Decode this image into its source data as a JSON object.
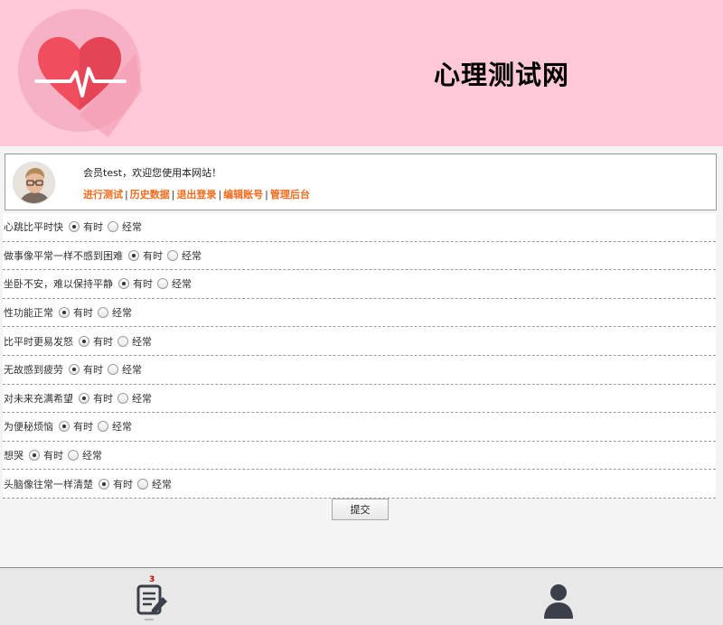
{
  "header": {
    "site_title": "心理测试网",
    "logo_icon": "heartbeat-logo-icon"
  },
  "user": {
    "welcome": "会员test，欢迎您使用本网站！",
    "links": [
      "进行测试",
      "历史数据",
      "退出登录",
      "编辑账号",
      "管理后台"
    ],
    "separator": "|"
  },
  "options": [
    "有时",
    "经常"
  ],
  "questions": [
    {
      "text": "心跳比平时快",
      "selected": "有时"
    },
    {
      "text": "做事像平常一样不感到困难",
      "selected": "有时"
    },
    {
      "text": "坐卧不安，难以保持平静",
      "selected": "有时"
    },
    {
      "text": "性功能正常",
      "selected": "有时"
    },
    {
      "text": "比平时更易发怒",
      "selected": "有时"
    },
    {
      "text": "无故感到疲劳",
      "selected": "有时"
    },
    {
      "text": "对未来充满希望",
      "selected": "有时"
    },
    {
      "text": "为便秘烦恼",
      "selected": "有时"
    },
    {
      "text": "想哭",
      "selected": "有时"
    },
    {
      "text": "头脑像往常一样清楚",
      "selected": "有时"
    }
  ],
  "submit_label": "提交",
  "footer": {
    "left_icon": "test-list-icon",
    "left_badge": "3",
    "right_icon": "user-profile-icon"
  },
  "colors": {
    "header_bg": "#ffc9d8",
    "link": "#f26b1d",
    "heart": "#f04e5e"
  }
}
